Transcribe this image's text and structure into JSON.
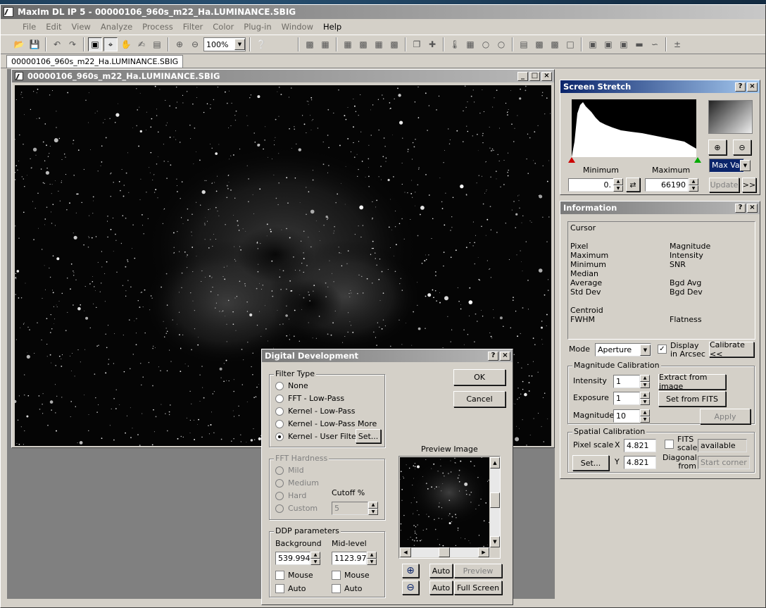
{
  "app": {
    "title": "MaxIm DL IP 5 - 00000106_960s_m22_Ha.LUMINANCE.SBIG"
  },
  "menu": [
    "File",
    "Edit",
    "View",
    "Analyze",
    "Process",
    "Filter",
    "Color",
    "Plug-in",
    "Window",
    "Help"
  ],
  "toolbar": {
    "zoom_value": "100%"
  },
  "tabs": [
    "00000106_960s_m22_Ha.LUMINANCE.SBIG"
  ],
  "image_window": {
    "title": "00000106_960s_m22_Ha.LUMINANCE.SBIG"
  },
  "screen_stretch": {
    "title": "Screen Stretch",
    "minimum_label": "Minimum",
    "maximum_label": "Maximum",
    "minimum_value": "0.",
    "maximum_value": "66190",
    "mode_select": "Max Val",
    "update_label": "Update",
    "more_label": ">>"
  },
  "information": {
    "title": "Information",
    "cursor_label": "Cursor",
    "left_labels": [
      "Pixel",
      "Maximum",
      "Minimum",
      "Median",
      "Average",
      "Std Dev"
    ],
    "right_labels": [
      "Magnitude",
      "Intensity",
      "SNR",
      "",
      "Bgd Avg",
      "Bgd Dev"
    ],
    "centroid_label": "Centroid",
    "fwhm_label": "FWHM",
    "flatness_label": "Flatness",
    "mode_label": "Mode",
    "mode_value": "Aperture",
    "display_arcsec_label": "Display in Arcsec",
    "display_arcsec_checked": true,
    "calibrate_label": "Calibrate <<",
    "mag_cal": {
      "title": "Magnitude Calibration",
      "intensity_label": "Intensity",
      "intensity_value": "1",
      "exposure_label": "Exposure",
      "exposure_value": "1",
      "magnitude_label": "Magnitude",
      "magnitude_value": "10",
      "extract_label": "Extract from image",
      "set_fits_label": "Set from FITS",
      "apply_label": "Apply"
    },
    "spatial_cal": {
      "title": "Spatial Calibration",
      "pixel_scale_label": "Pixel scale",
      "x_label": "X",
      "x_value": "4.821",
      "y_label": "Y",
      "y_value": "4.821",
      "set_label": "Set...",
      "fits_scale_label": "FITS scale",
      "fits_scale_value": "available",
      "diagonal_label": "Diagonal from",
      "diagonal_value": "Start corner"
    }
  },
  "dialog": {
    "title": "Digital Development",
    "ok_label": "OK",
    "cancel_label": "Cancel",
    "filter_type": {
      "title": "Filter Type",
      "options": [
        "None",
        "FFT - Low-Pass",
        "Kernel - Low-Pass",
        "Kernel - Low-Pass More",
        "Kernel - User Filter"
      ],
      "selected_index": 4,
      "set_label": "Set..."
    },
    "fft_hardness": {
      "title": "FFT Hardness",
      "options": [
        "Mild",
        "Medium",
        "Hard",
        "Custom"
      ],
      "cutoff_label": "Cutoff %",
      "cutoff_value": "5"
    },
    "ddp": {
      "title": "DDP parameters",
      "background_label": "Background",
      "background_value": "539.994",
      "midlevel_label": "Mid-level",
      "midlevel_value": "1123.97",
      "mouse_label": "Mouse",
      "auto_label": "Auto"
    },
    "preview": {
      "label": "Preview Image",
      "auto_label": "Auto",
      "preview_btn_label": "Preview",
      "fullscreen_label": "Full Screen"
    }
  }
}
